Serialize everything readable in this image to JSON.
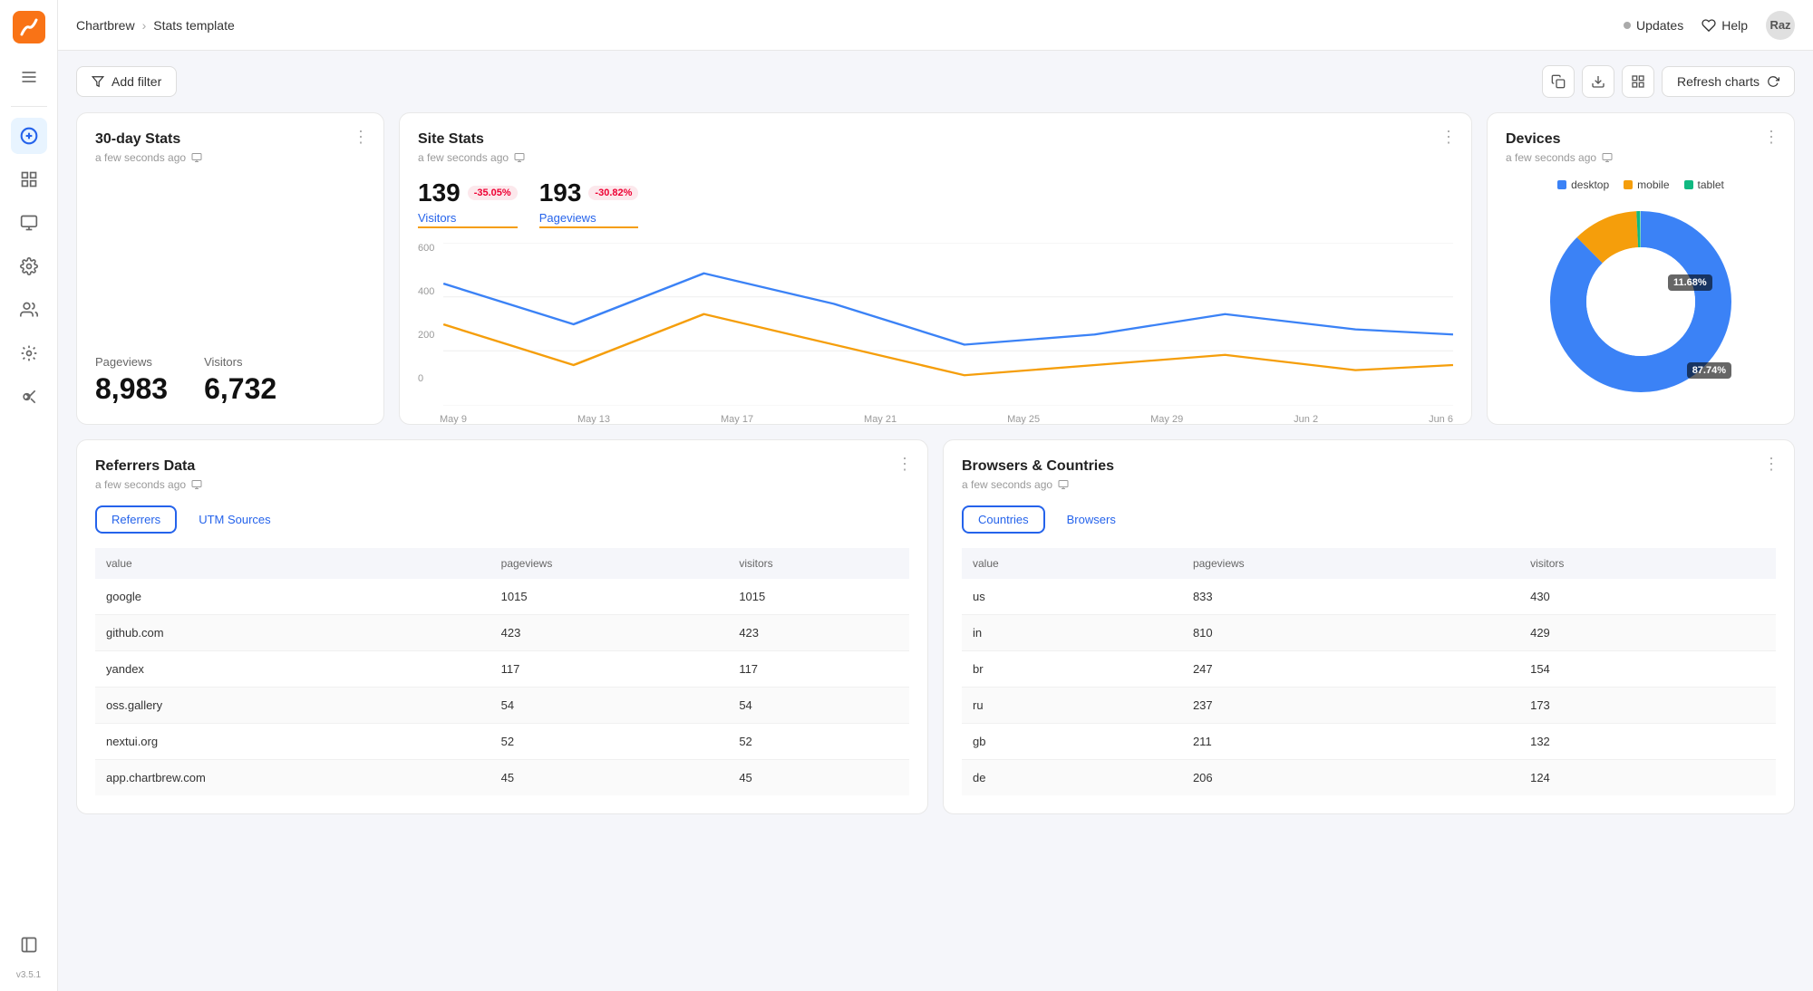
{
  "app": {
    "name": "Chartbrew",
    "page": "Stats template",
    "version": "v3.5.1"
  },
  "navbar": {
    "breadcrumb_root": "Chartbrew",
    "breadcrumb_separator": "›",
    "breadcrumb_current": "Stats template",
    "updates_label": "Updates",
    "help_label": "Help",
    "avatar_initials": "Raz"
  },
  "toolbar": {
    "add_filter_label": "Add filter",
    "refresh_label": "Refresh charts"
  },
  "card_30day": {
    "title": "30-day Stats",
    "subtitle": "a few seconds ago",
    "pageviews_label": "Pageviews",
    "pageviews_value": "8,983",
    "visitors_label": "Visitors",
    "visitors_value": "6,732"
  },
  "card_site": {
    "title": "Site Stats",
    "subtitle": "a few seconds ago",
    "visitors_num": "139",
    "visitors_badge": "-35.05%",
    "pageviews_num": "193",
    "pageviews_badge": "-30.82%",
    "visitors_label": "Visitors",
    "pageviews_label": "Pageviews",
    "chart": {
      "y_labels": [
        "600",
        "400",
        "200",
        "0"
      ],
      "x_labels": [
        "May 9",
        "May 13",
        "May 17",
        "May 21",
        "May 25",
        "May 29",
        "Jun 2",
        "Jun 6"
      ]
    }
  },
  "card_devices": {
    "title": "Devices",
    "subtitle": "a few seconds ago",
    "legend": [
      {
        "label": "desktop",
        "color": "#3b82f6"
      },
      {
        "label": "mobile",
        "color": "#f59e0b"
      },
      {
        "label": "tablet",
        "color": "#10b981"
      }
    ],
    "desktop_pct": "87.74%",
    "mobile_pct": "11.68%"
  },
  "card_referrers": {
    "title": "Referrers Data",
    "subtitle": "a few seconds ago",
    "tab_referrers": "Referrers",
    "tab_utm": "UTM Sources",
    "columns": [
      "value",
      "pageviews",
      "visitors"
    ],
    "rows": [
      {
        "value": "google",
        "pageviews": "1015",
        "visitors": "1015"
      },
      {
        "value": "github.com",
        "pageviews": "423",
        "visitors": "423"
      },
      {
        "value": "yandex",
        "pageviews": "117",
        "visitors": "117"
      },
      {
        "value": "oss.gallery",
        "pageviews": "54",
        "visitors": "54"
      },
      {
        "value": "nextui.org",
        "pageviews": "52",
        "visitors": "52"
      },
      {
        "value": "app.chartbrew.com",
        "pageviews": "45",
        "visitors": "45"
      }
    ]
  },
  "card_browsers_countries": {
    "title": "Browsers & Countries",
    "subtitle": "a few seconds ago",
    "tab_countries": "Countries",
    "tab_browsers": "Browsers",
    "columns": [
      "value",
      "pageviews",
      "visitors"
    ],
    "rows": [
      {
        "value": "us",
        "pageviews": "833",
        "visitors": "430"
      },
      {
        "value": "in",
        "pageviews": "810",
        "visitors": "429"
      },
      {
        "value": "br",
        "pageviews": "247",
        "visitors": "154"
      },
      {
        "value": "ru",
        "pageviews": "237",
        "visitors": "173"
      },
      {
        "value": "gb",
        "pageviews": "211",
        "visitors": "132"
      },
      {
        "value": "de",
        "pageviews": "206",
        "visitors": "124"
      }
    ]
  },
  "sidebar": {
    "items": [
      {
        "name": "menu",
        "icon": "menu"
      },
      {
        "name": "add",
        "icon": "add",
        "active": true
      },
      {
        "name": "grid",
        "icon": "grid"
      },
      {
        "name": "monitor",
        "icon": "monitor"
      },
      {
        "name": "settings",
        "icon": "settings"
      },
      {
        "name": "team",
        "icon": "team"
      },
      {
        "name": "integrations",
        "icon": "integrations"
      },
      {
        "name": "variables",
        "icon": "variables"
      }
    ]
  }
}
